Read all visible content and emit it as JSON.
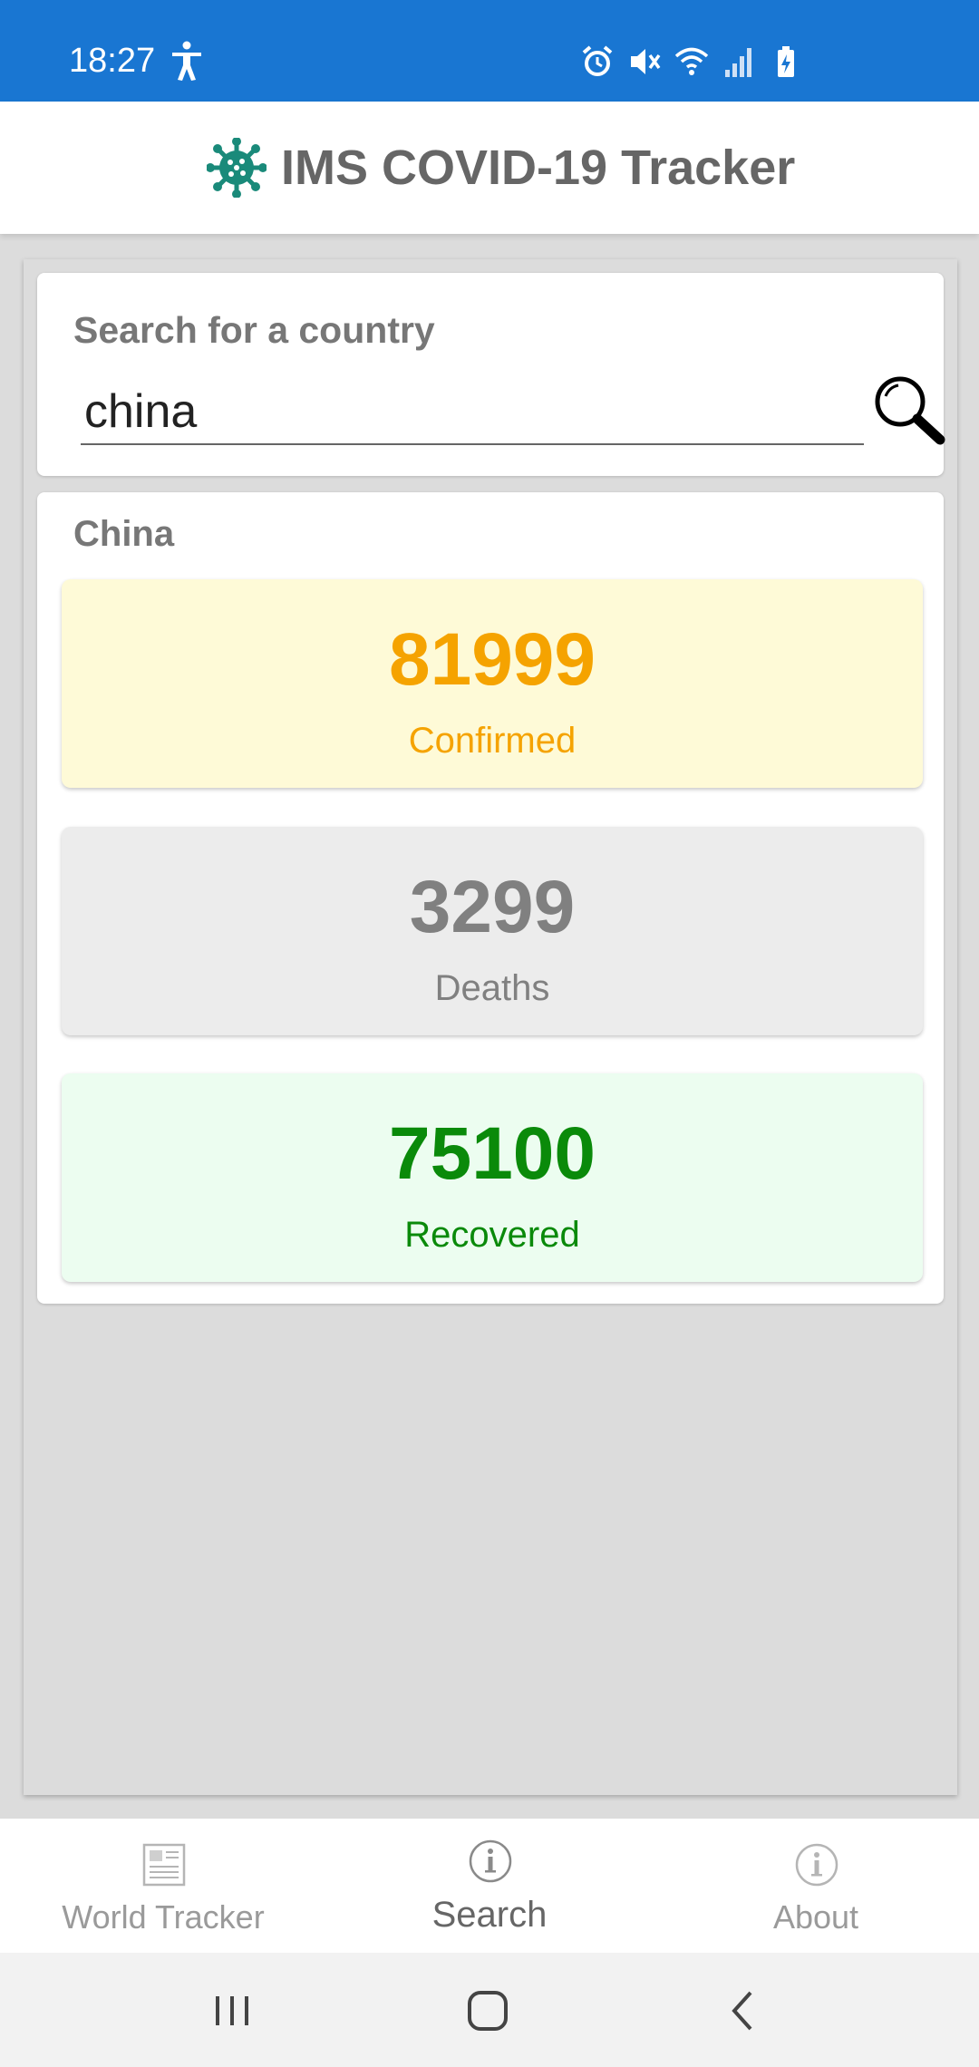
{
  "status_bar": {
    "time": "18:27",
    "icons": [
      "accessibility-icon",
      "alarm-icon",
      "mute-icon",
      "wifi-icon",
      "signal-icon",
      "battery-charging-icon"
    ]
  },
  "header": {
    "title": "IMS COVID-19 Tracker",
    "logo_icon": "virus-icon",
    "logo_color": "#1a8a7a"
  },
  "search": {
    "label": "Search for a country",
    "value": "china",
    "button_icon": "magnifier-icon"
  },
  "result": {
    "country": "China",
    "confirmed": {
      "value": "81999",
      "label": "Confirmed",
      "color": "#f5a300"
    },
    "deaths": {
      "value": "3299",
      "label": "Deaths",
      "color": "#808080"
    },
    "recovered": {
      "value": "75100",
      "label": "Recovered",
      "color": "#0a8a0a"
    }
  },
  "tabs": [
    {
      "label": "World Tracker",
      "icon": "newspaper-icon",
      "active": false
    },
    {
      "label": "Search",
      "icon": "info-icon",
      "active": true
    },
    {
      "label": "About",
      "icon": "info-icon",
      "active": false
    }
  ],
  "nav_bar": {
    "buttons": [
      "recents-button",
      "home-button",
      "back-button"
    ]
  },
  "colors": {
    "status_bar": "#1976d2",
    "background": "#dcdcdc"
  }
}
